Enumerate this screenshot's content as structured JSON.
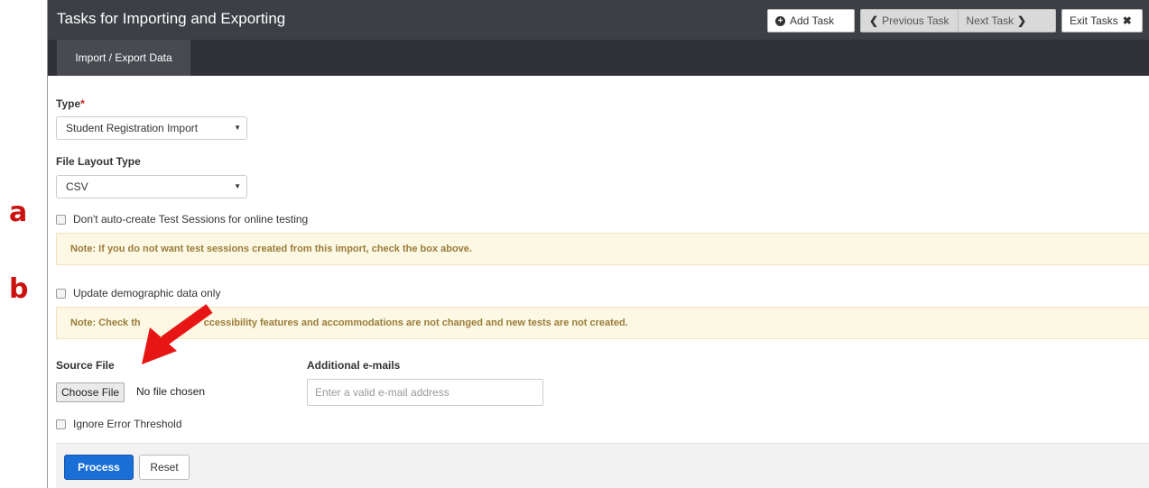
{
  "callouts": {
    "a": "a",
    "b": "b"
  },
  "header": {
    "title": "Tasks for Importing and Exporting",
    "add_task": "Add Task",
    "previous_task": "Previous Task",
    "next_task": "Next Task",
    "exit_tasks": "Exit Tasks"
  },
  "tabs": {
    "active": "Import / Export Data"
  },
  "form": {
    "type_label": "Type",
    "required_mark": "*",
    "type_value": "Student Registration Import",
    "layout_label": "File Layout Type",
    "layout_value": "CSV",
    "checkbox_sessions": "Don't auto-create Test Sessions for online testing",
    "note_sessions": "Note: If you do not want test sessions created from this import, check the box above.",
    "checkbox_demographic": "Update demographic data only",
    "note_demographic_start": "Note: Check th",
    "note_demographic_end": "ccessibility features and accommodations are not changed and new tests are not created.",
    "source_file_label": "Source File",
    "choose_file": "Choose File",
    "no_file": "No file chosen",
    "emails_label": "Additional e-mails",
    "emails_placeholder": "Enter a valid e-mail address",
    "checkbox_threshold": "Ignore Error Threshold"
  },
  "footer": {
    "process": "Process",
    "reset": "Reset"
  },
  "colors": {
    "annotation": "#cc1111",
    "primary": "#1a6fd6",
    "note_bg": "#fcf8e3"
  },
  "icons": [
    "plus-circle-icon",
    "chevron-left-icon",
    "chevron-right-icon",
    "close-icon",
    "caret-down-icon",
    "arrow-annotation"
  ]
}
